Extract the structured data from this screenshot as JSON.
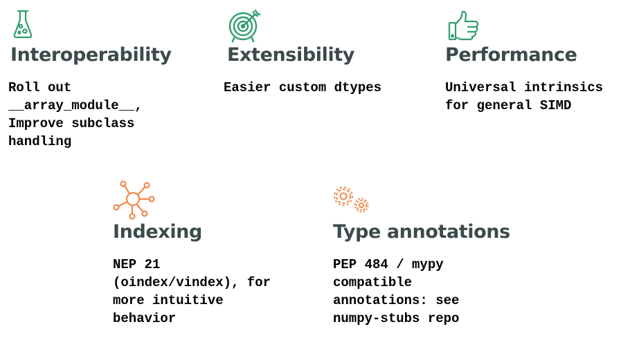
{
  "colors": {
    "green_icon": "#2e9e6b",
    "orange_icon": "#f08a4b",
    "title_text": "#3b4a4a",
    "body_text": "#000000"
  },
  "cards": [
    {
      "icon": "flask-icon",
      "title": "Interoperability",
      "description": "Roll out\n__array_module__,\nImprove subclass\nhandling"
    },
    {
      "icon": "target-icon",
      "title": "Extensibility",
      "description": "Easier custom dtypes"
    },
    {
      "icon": "thumbs-up-icon",
      "title": "Performance",
      "description": "Universal intrinsics\nfor general SIMD"
    },
    {
      "icon": "network-hub-icon",
      "title": "Indexing",
      "description": "NEP 21\n(oindex/vindex), for\nmore intuitive\nbehavior"
    },
    {
      "icon": "gears-icon",
      "title": "Type annotations",
      "description": "PEP 484 / mypy\ncompatible\nannotations: see\nnumpy-stubs repo"
    }
  ]
}
